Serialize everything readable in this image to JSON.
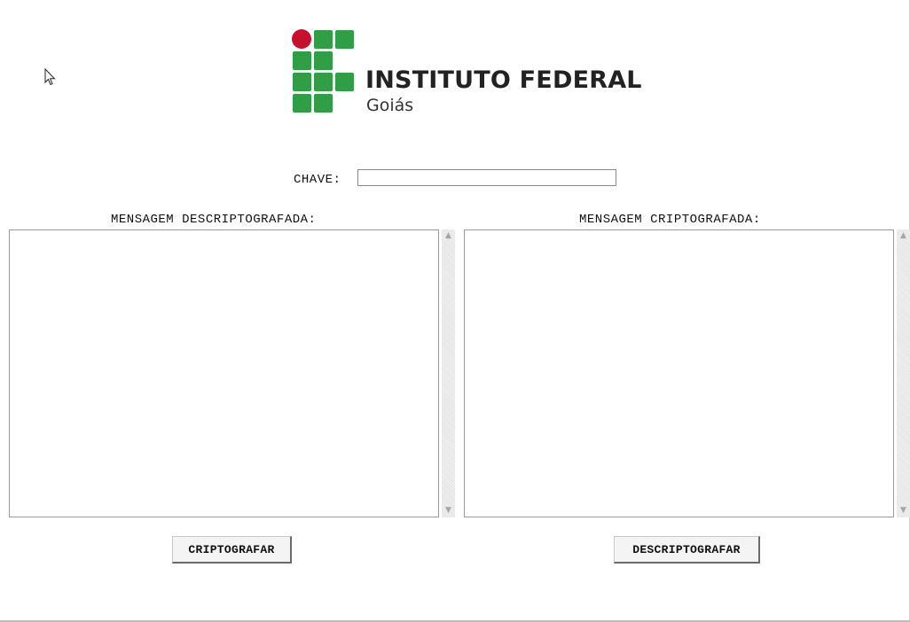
{
  "logo": {
    "title": "INSTITUTO FEDERAL",
    "subtitle": "Goiás",
    "green": "#2f9e44",
    "red": "#c8102e"
  },
  "key": {
    "label": "CHAVE:",
    "value": ""
  },
  "left_panel": {
    "label": "MENSAGEM DESCRIPTOGRAFADA:",
    "value": ""
  },
  "right_panel": {
    "label": "MENSAGEM CRIPTOGRAFADA:",
    "value": ""
  },
  "buttons": {
    "encrypt": "CRIPTOGRAFAR",
    "decrypt": "DESCRIPTOGRAFAR"
  },
  "icons": {
    "cursor": "mouse-pointer-icon",
    "scroll_up": "scroll-up-arrow-icon",
    "scroll_down": "scroll-down-arrow-icon"
  }
}
